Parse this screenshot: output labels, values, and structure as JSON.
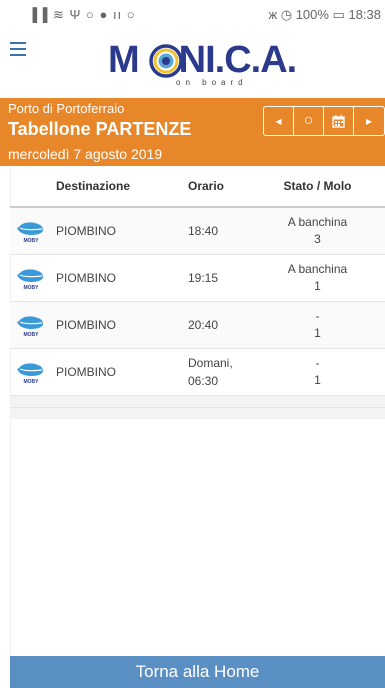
{
  "statusbar": {
    "left_icons": "▐▐ ≋ Ψ ○ ● ıı ○",
    "right_text": "ж ◷ 100% ▭ 18:38"
  },
  "header": {
    "logo_prefix": "M",
    "logo_suffix": "NI.C.A.",
    "logo_tagline": "on board",
    "colors": {
      "brand": "#2b3a8c",
      "accent_orange": "#e8872a",
      "accent_yellow": "#f2c230"
    }
  },
  "board": {
    "port": "Porto di Portoferraio",
    "title": "Tabellone PARTENZE",
    "date": "mercoledì 7 agosto 2019",
    "nav": {
      "prev": "◂",
      "today": "○",
      "calendar": "calendar-icon",
      "next": "▸"
    }
  },
  "table": {
    "headers": {
      "logo": "",
      "destination": "Destinazione",
      "time": "Orario",
      "status": "Stato / Molo"
    },
    "rows": [
      {
        "company_logo": "moby-whale-icon",
        "destination": "PIOMBINO",
        "time": "18:40",
        "status": "A banchina",
        "pier": "3"
      },
      {
        "company_logo": "moby-whale-icon",
        "destination": "PIOMBINO",
        "time": "19:15",
        "status": "A banchina",
        "pier": "1"
      },
      {
        "company_logo": "moby-whale-icon",
        "destination": "PIOMBINO",
        "time": "20:40",
        "status": "-",
        "pier": "1"
      },
      {
        "company_logo": "moby-whale-icon",
        "destination": "PIOMBINO",
        "time": "Domani, 06:30",
        "status": "-",
        "pier": "1"
      }
    ]
  },
  "footer": {
    "home_label": "Torna alla Home"
  }
}
